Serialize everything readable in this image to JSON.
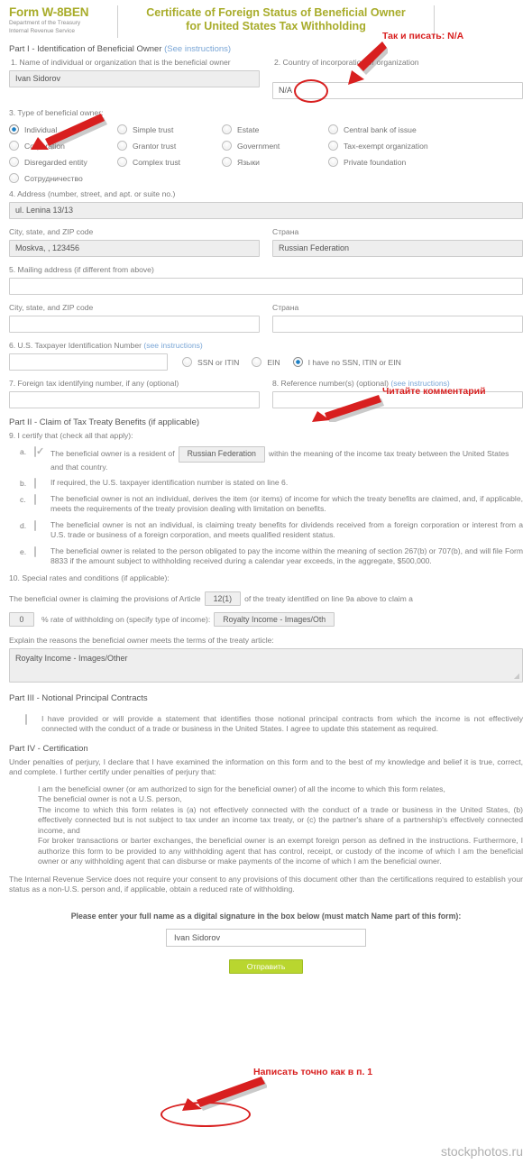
{
  "header": {
    "form_title": "Form W-8BEN",
    "dept_line1": "Department of the Treasury",
    "dept_line2": "Internal Revenue Service",
    "cert_line1": "Certificate of Foreign Status of Beneficial Owner",
    "cert_line2": "for United States Tax Withholding",
    "accent_color": "#a8ac2a"
  },
  "annotations": {
    "na_note_prefix": "Так и писать: ",
    "na_note_value": "N/A",
    "read_comment": "Читайте комментарий",
    "sign_note": "Написать точно как в п. 1",
    "color": "#d81f1f"
  },
  "part1": {
    "heading": "Part I - Identification of Beneficial Owner ",
    "heading_link": "(See instructions)",
    "f1_label": "1. Name of individual or organization that is the beneficial owner",
    "f1_value": "Ivan Sidorov",
    "f2_label": "2. Country of incorporation or organization",
    "f2_value": "N/A",
    "f3_label": "3. Type of beneficial owner:",
    "types": [
      {
        "label": "Individual",
        "checked": true
      },
      {
        "label": "Simple trust",
        "checked": false
      },
      {
        "label": "Estate",
        "checked": false
      },
      {
        "label": "Central bank of issue",
        "checked": false
      },
      {
        "label": "Corporation",
        "checked": false
      },
      {
        "label": "Grantor trust",
        "checked": false
      },
      {
        "label": "Government",
        "checked": false
      },
      {
        "label": "Tax-exempt organization",
        "checked": false
      },
      {
        "label": "Disregarded entity",
        "checked": false
      },
      {
        "label": "Complex trust",
        "checked": false
      },
      {
        "label": "Языки",
        "checked": false
      },
      {
        "label": "Private foundation",
        "checked": false
      },
      {
        "label": "Сотрудничество",
        "checked": false
      }
    ],
    "f4_label": "4. Address (number, street, and apt. or suite no.)",
    "f4_value": "ul. Lenina 13/13",
    "f4_city_label": "City, state, and ZIP code",
    "f4_city_value": "Moskva, , 123456",
    "f4_country_label": "Страна",
    "f4_country_value": "Russian Federation",
    "f5_label": "5. Mailing address (if different from above)",
    "f5_value": "",
    "f5_city_label": "City, state, and ZIP code",
    "f5_city_value": "",
    "f5_country_label": "Страна",
    "f5_country_value": "",
    "f6_label": "6. U.S. Taxpayer Identification Number ",
    "f6_link": "(see instructions)",
    "f6_value": "",
    "tin_options": [
      {
        "label": "SSN or ITIN",
        "checked": false
      },
      {
        "label": "EIN",
        "checked": false
      },
      {
        "label": "I have no SSN, ITIN or EIN",
        "checked": true
      }
    ],
    "f7_label": "7. Foreign tax identifying number, if any (optional)",
    "f7_value": "",
    "f8_label": "8. Reference number(s) (optional) ",
    "f8_link": "(see instructions)",
    "f8_value": ""
  },
  "part2": {
    "heading": "Part II - Claim of Tax Treaty Benefits (if applicable)",
    "f9_label": "9. I certify that (check all that apply):",
    "clauses": [
      {
        "letter": "a.",
        "checked": true,
        "text_before": "The beneficial owner is a resident of",
        "pill": "Russian Federation",
        "text_after": "within the meaning of the income tax treaty between the United States and that country."
      },
      {
        "letter": "b.",
        "checked": false,
        "text": "If required, the U.S. taxpayer identification number is stated on line 6."
      },
      {
        "letter": "c.",
        "checked": false,
        "text": "The beneficial owner is not an individual, derives the item (or items) of income for which the treaty benefits are claimed, and, if applicable, meets the requirements of the treaty provision dealing with limitation on benefits."
      },
      {
        "letter": "d.",
        "checked": false,
        "text": "The beneficial owner is not an individual, is claiming treaty benefits for dividends received from a foreign corporation or interest from a U.S. trade or business of a foreign corporation, and meets qualified resident status."
      },
      {
        "letter": "e.",
        "checked": false,
        "text": "The beneficial owner is related to the person obligated to pay the income within the meaning of section 267(b) or 707(b), and will file Form 8833 if the amount subject to withholding received during a calendar year exceeds, in the aggregate, $500,000."
      }
    ],
    "f10_label": "10. Special rates and conditions (if applicable):",
    "f10_line1_a": "The beneficial owner is claiming the provisions of Article",
    "f10_article": "12(1)",
    "f10_line1_b": "of the treaty identified on line 9a above to claim a",
    "f10_rate": "0",
    "f10_line2": "% rate of withholding on (specify type of income):",
    "f10_income": "Royalty Income - Images/Oth",
    "f10_explain_label": "Explain the reasons the beneficial owner meets the terms of the treaty article:",
    "f10_explain_value": "Royalty Income - Images/Other"
  },
  "part3": {
    "heading": "Part III - Notional Principal Contracts",
    "checked": false,
    "text": "I have provided or will provide a statement that identifies those notional principal contracts from which the income is not effectively connected with the conduct of a trade or business in the United States. I agree to update this statement as required."
  },
  "part4": {
    "heading": "Part IV - Certification",
    "intro": "Under penalties of perjury, I declare that I have examined the information on this form and to the best of my knowledge and belief it is true, correct, and complete. I further certify under penalties of perjury that:",
    "bullets": [
      "I am the beneficial owner (or am authorized to sign for the beneficial owner) of all the income to which this form relates,",
      "The beneficial owner is not a U.S. person,",
      "The income to which this form relates is (a) not effectively connected with the conduct of a trade or business in the United States, (b) effectively connected but is not subject to tax under an income tax treaty, or (c) the partner's share of a partnership's effectively connected income, and",
      "For broker transactions or barter exchanges, the beneficial owner is an exempt foreign person as defined in the instructions. Furthermore, I authorize this form to be provided to any withholding agent that has control, receipt, or custody of the income of which I am the beneficial owner or any withholding agent that can disburse or make payments of the income of which I am the beneficial owner."
    ],
    "irs_note": "The Internal Revenue Service does not require your consent to any provisions of this document other than the certifications required to establish your status as a non-U.S. person and, if applicable, obtain a reduced rate of withholding.",
    "signature_prompt": "Please enter your full name as a digital signature in the box below (must match Name part of this form):",
    "signature_value": "Ivan Sidorov",
    "submit_label": "Отправить",
    "submit_color": "#b9d62f"
  },
  "watermark": "stockphotos.ru"
}
